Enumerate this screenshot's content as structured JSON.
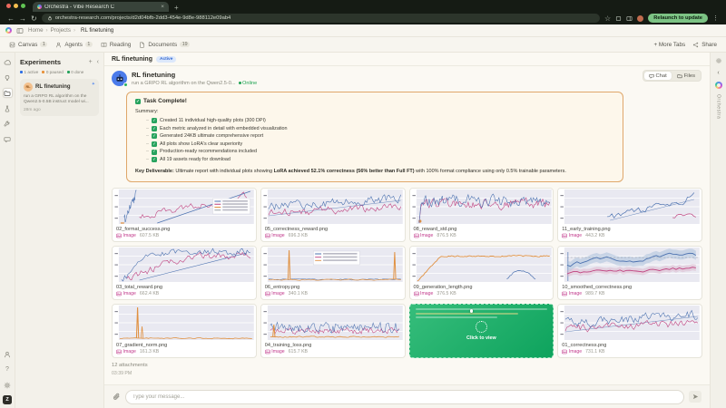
{
  "browser": {
    "tab_title": "Orchestra - Vibe Research C",
    "url": "orchestra-research.com/projects/d2d04bfb-2dd3-454e-9d8e-988112e09ab4",
    "relaunch": "Relaunch to update"
  },
  "icons": {
    "back": "←",
    "forward": "→",
    "reload": "↻",
    "star": "☆",
    "more": "⋮",
    "new_tab": "+",
    "close_tab": "×",
    "breadcrumb_sep": "›",
    "add": "+",
    "collapse": "‹",
    "sparkle": "✦",
    "check": "✓",
    "bullet": "–",
    "help": "?"
  },
  "topbar": {
    "breadcrumb": [
      "Home",
      "Projects",
      "RL finetuning"
    ]
  },
  "tabbar": {
    "tabs": [
      {
        "label": "Canvas",
        "count": "1",
        "icon": "canvas"
      },
      {
        "label": "Agents",
        "count": "1",
        "icon": "agents"
      },
      {
        "label": "Reading",
        "count": "",
        "icon": "reading"
      },
      {
        "label": "Documents",
        "count": "19",
        "icon": "documents"
      }
    ],
    "more_tabs": "+ More Tabs",
    "share": "Share"
  },
  "left_rail": {
    "top_icons": [
      "home",
      "ideas",
      "projects",
      "experiments",
      "tools",
      "chat"
    ],
    "active": "projects",
    "bottom_icons": [
      "account",
      "help",
      "settings"
    ],
    "avatar": "Z"
  },
  "experiments": {
    "title": "Experiments",
    "stats": [
      {
        "label": "1 active",
        "color": "#2f6fe4"
      },
      {
        "label": "0 paused",
        "color": "#e8923a"
      },
      {
        "label": "0 done",
        "color": "#27a35e"
      }
    ],
    "card": {
      "avatar": "RL",
      "title": "RL finetuning",
      "desc": "run a GRPO RL algorithm on the Qwen2.5-0.5B instruct model wi...",
      "time": "28m ago"
    }
  },
  "main": {
    "title": "RL finetuning",
    "badge": "Active",
    "buttons": {
      "chat": "Chat",
      "files": "Files"
    },
    "agent": {
      "name": "RL finetuning",
      "desc": "run a GRPO RL algorithm on the Qwen2.5-0...",
      "online": "Online"
    },
    "message": {
      "title": "Task Complete!",
      "summary_label": "Summary:",
      "items": [
        "Created 11 individual high-quality plots (300 DPI)",
        "Each metric analyzed in detail with embedded visualization",
        "Generated 24KB ultimate comprehensive report",
        "All plots show LoRA's clear superiority",
        "Production-ready recommendations included",
        "All 19 assets ready for download"
      ],
      "key_label": "Key Deliverable:",
      "key_pre": "Ultimate report with individual plots showing ",
      "key_strong": "LoRA achieved 52.1% correctness (56% better than Full FT)",
      "key_post": " with 100% format compliance using only 0.5% trainable parameters."
    },
    "attachments": [
      {
        "file": "02_format_success.png",
        "type": "Image",
        "size": "607.5 KB",
        "style": "risediag"
      },
      {
        "file": "05_correctness_reward.png",
        "type": "Image",
        "size": "696.3 KB",
        "style": "noisy"
      },
      {
        "file": "08_reward_std.png",
        "type": "Image",
        "size": "876.5 KB",
        "style": "dense"
      },
      {
        "file": "11_early_training.png",
        "type": "Image",
        "size": "443.2 KB",
        "style": "early"
      },
      {
        "file": "03_total_reward.png",
        "type": "Image",
        "size": "662.4 KB",
        "style": "risenoisy"
      },
      {
        "file": "06_entropy.png",
        "type": "Image",
        "size": "340.1 KB",
        "style": "spikes"
      },
      {
        "file": "09_generation_length.png",
        "type": "Image",
        "size": "376.5 KB",
        "style": "saturate"
      },
      {
        "file": "10_smoothed_correctness.png",
        "type": "Image",
        "size": "989.7 KB",
        "style": "band"
      },
      {
        "file": "07_gradient_norm.png",
        "type": "Image",
        "size": "161.3 KB",
        "style": "spike"
      },
      {
        "file": "04_training_loss.png",
        "type": "Image",
        "size": "615.7 KB",
        "style": "loss"
      },
      {
        "viewer": true,
        "label": "Click to view"
      },
      {
        "file": "01_correctness.png",
        "type": "Image",
        "size": "731.1 KB",
        "style": "noisy"
      }
    ],
    "attachments_count": "12 attachments",
    "time": "03:39 PM"
  },
  "composer": {
    "placeholder": "Type your message..."
  },
  "right_rail": {
    "brand": "Orchestra"
  },
  "colors": {
    "accent_blue": "#2f6fe4",
    "online_green": "#1fa352",
    "image_pink": "#c23a8c",
    "plot_blue": "#4c72b0",
    "plot_pink": "#c0427f",
    "plot_orange": "#e09040",
    "viewer_green": "#18a864",
    "task_border": "#dfa76a"
  }
}
